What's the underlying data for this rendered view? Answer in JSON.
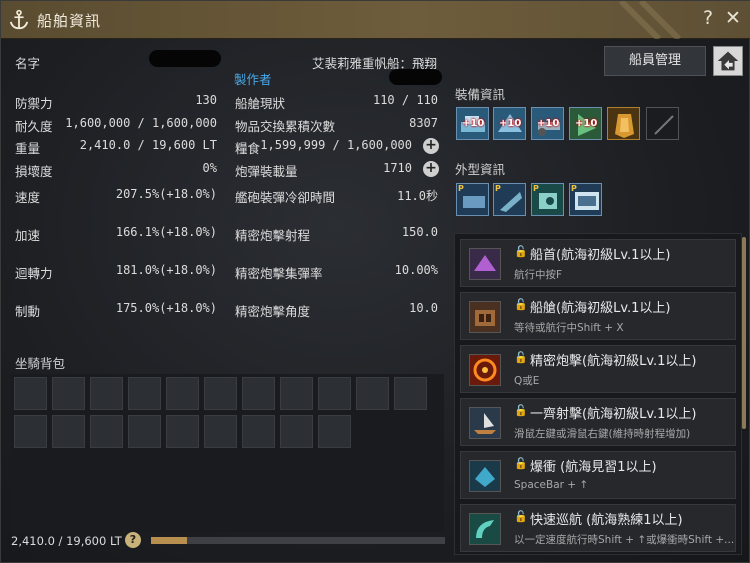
{
  "window": {
    "title": "船舶資訊",
    "help": "?",
    "close": "✕"
  },
  "ship": {
    "name_label": "名字",
    "maker_label": "製作者",
    "ship_type": "艾裴莉雅重帆船：飛翔"
  },
  "left_stats": [
    {
      "label": "防禦力",
      "value": "130"
    },
    {
      "label": "耐久度",
      "value": "1,600,000 / 1,600,000"
    },
    {
      "label": "重量",
      "value": "2,410.0 / 19,600 LT"
    },
    {
      "label": "損壞度",
      "value": "0%"
    },
    {
      "label": "速度",
      "value": "207.5%(+18.0%)"
    },
    {
      "label": "加速",
      "value": "166.1%(+18.0%)"
    },
    {
      "label": "迴轉力",
      "value": "181.0%(+18.0%)"
    },
    {
      "label": "制動",
      "value": "175.0%(+18.0%)"
    }
  ],
  "right_stats": [
    {
      "label": "船艙現狀",
      "value": "110 / 110"
    },
    {
      "label": "物品交換累積次數",
      "value": "8307"
    },
    {
      "label": "糧食",
      "value": "1,599,999 / 1,600,000"
    },
    {
      "label": "炮彈裝載量",
      "value": "1710"
    },
    {
      "label": "艦砲裝彈冷卻時間",
      "value": "11.0秒"
    },
    {
      "label": "精密炮擊射程",
      "value": "150.0"
    },
    {
      "label": "精密炮擊集彈率",
      "value": "10.00%"
    },
    {
      "label": "精密炮擊角度",
      "value": "10.0"
    }
  ],
  "buttons": {
    "crew": "船員管理"
  },
  "equipment": {
    "title": "裝備資訊",
    "slots": [
      {
        "icon": "figurehead-icon",
        "tag": "+10"
      },
      {
        "icon": "plating-icon",
        "tag": "+10"
      },
      {
        "icon": "cannon-icon",
        "tag": "+10"
      },
      {
        "icon": "sail-icon",
        "tag": "+10"
      },
      {
        "icon": "emblem-icon",
        "tag": ""
      },
      {
        "icon": "empty-slot-icon",
        "tag": ""
      }
    ]
  },
  "appearance": {
    "title": "外型資訊",
    "badge": "P"
  },
  "skills": [
    {
      "name": "船首(航海初級Lv.1以上)",
      "key": "航行中按F",
      "icon": "figurehead-skill-icon"
    },
    {
      "name": "船艙(航海初級Lv.1以上)",
      "key": "等待或航行中Shift + X",
      "icon": "cabin-skill-icon"
    },
    {
      "name": "精密炮擊(航海初級Lv.1以上)",
      "key": "Q或E",
      "icon": "target-skill-icon"
    },
    {
      "name": "一齊射擊(航海初級Lv.1以上)",
      "key": "滑鼠左鍵或滑鼠右鍵(維持時射程增加)",
      "icon": "broadside-skill-icon"
    },
    {
      "name": "爆衝 (航海見習1以上)",
      "key": "SpaceBar + ↑",
      "icon": "dash-skill-icon"
    },
    {
      "name": "快速巡航 (航海熟練1以上)",
      "key": "以一定速度航行時Shift + ↑或爆衝時Shift +...",
      "icon": "cruise-skill-icon"
    }
  ],
  "bag": {
    "title": "坐騎背包",
    "weight": "2,410.0 / 19,600 LT",
    "weight_ratio": 0.123,
    "help": "?"
  },
  "colors": {
    "accent_gold": "#b98f4f",
    "maker_blue": "#4aa8e8",
    "title_bar": "#6e5d3c"
  }
}
